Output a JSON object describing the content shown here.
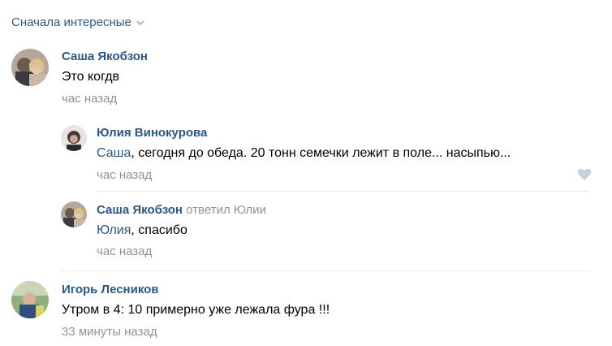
{
  "sort": {
    "label": "Сначала интересные"
  },
  "comments": [
    {
      "author": "Саша Якобзон",
      "text": "Это когдв",
      "time": "час назад"
    },
    {
      "author": "Юлия Винокурова",
      "mention": "Саша",
      "text": ", сегодня до обеда. 20 тонн семечки лежит в поле... насыпью...",
      "time": "час назад"
    },
    {
      "author": "Саша Якобзон",
      "reply_note": "ответил Юлии",
      "mention": "Юлия",
      "text": ", спасибо",
      "time": "час назад"
    },
    {
      "author": "Игорь Лесников",
      "text": "Утром в 4: 10 примерно уже лежала фура !!!",
      "time": "33 минуты назад"
    }
  ],
  "icons": {
    "like": "heart-icon",
    "sort": "chevron-down-icon"
  },
  "colors": {
    "link": "#2a5885",
    "meta": "#939393",
    "divider": "#e7e8ec"
  }
}
